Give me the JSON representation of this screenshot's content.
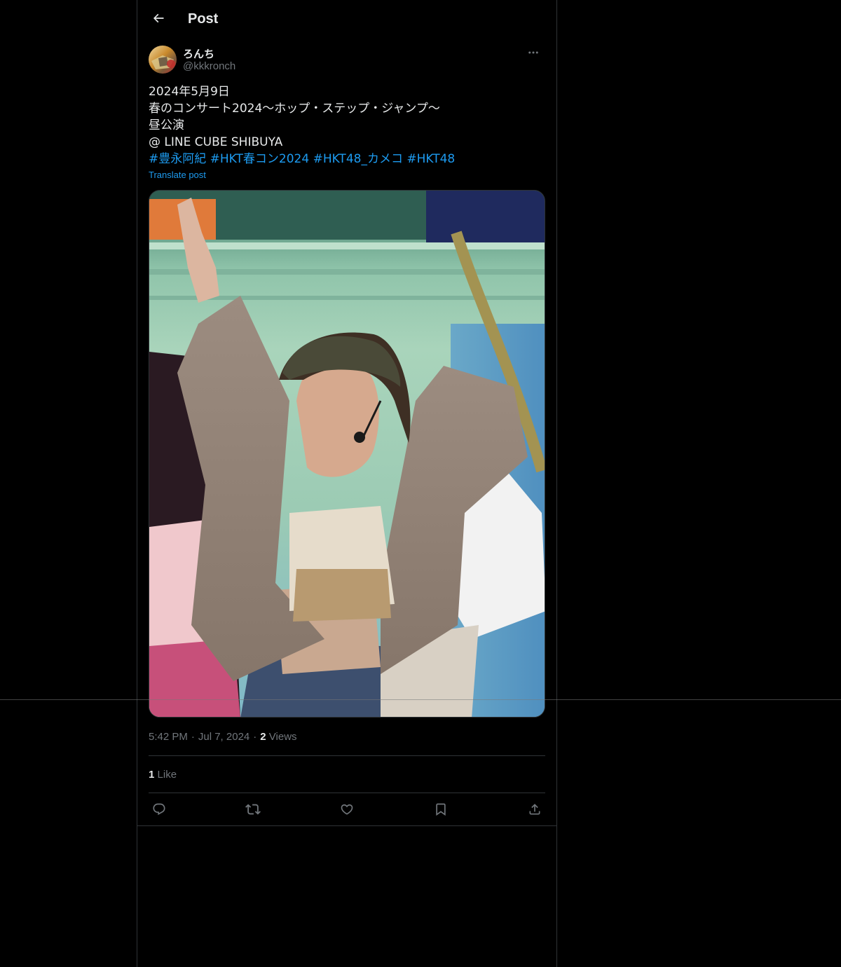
{
  "header": {
    "title": "Post",
    "back_icon": "arrow-left-icon"
  },
  "author": {
    "display_name": "ろんち",
    "handle": "@kkkronch",
    "more_icon": "more-horizontal-icon"
  },
  "tweet": {
    "lines": [
      "2024年5月9日",
      "春のコンサート2024〜ホップ・ステップ・ジャンプ〜",
      "昼公演",
      "@ LINE CUBE SHIBUYA"
    ],
    "hashtags": [
      "#豊永阿紀",
      "#HKT春コン2024",
      "#HKT48_カメコ",
      "#HKT48"
    ],
    "translate_label": "Translate post"
  },
  "media": {
    "description_icon": "photo"
  },
  "meta": {
    "time": "5:42 PM",
    "date": "Jul 7, 2024",
    "views_count": "2",
    "views_label": "Views",
    "separator": "·"
  },
  "stats": {
    "likes_count": "1",
    "likes_label": "Like"
  },
  "actions": {
    "reply_icon": "reply-icon",
    "repost_icon": "repost-icon",
    "like_icon": "heart-icon",
    "bookmark_icon": "bookmark-icon",
    "share_icon": "share-icon"
  },
  "colors": {
    "background": "#000000",
    "text": "#e7e9ea",
    "secondary": "#71767b",
    "accent": "#1d9bf0",
    "border": "#2f3336"
  }
}
